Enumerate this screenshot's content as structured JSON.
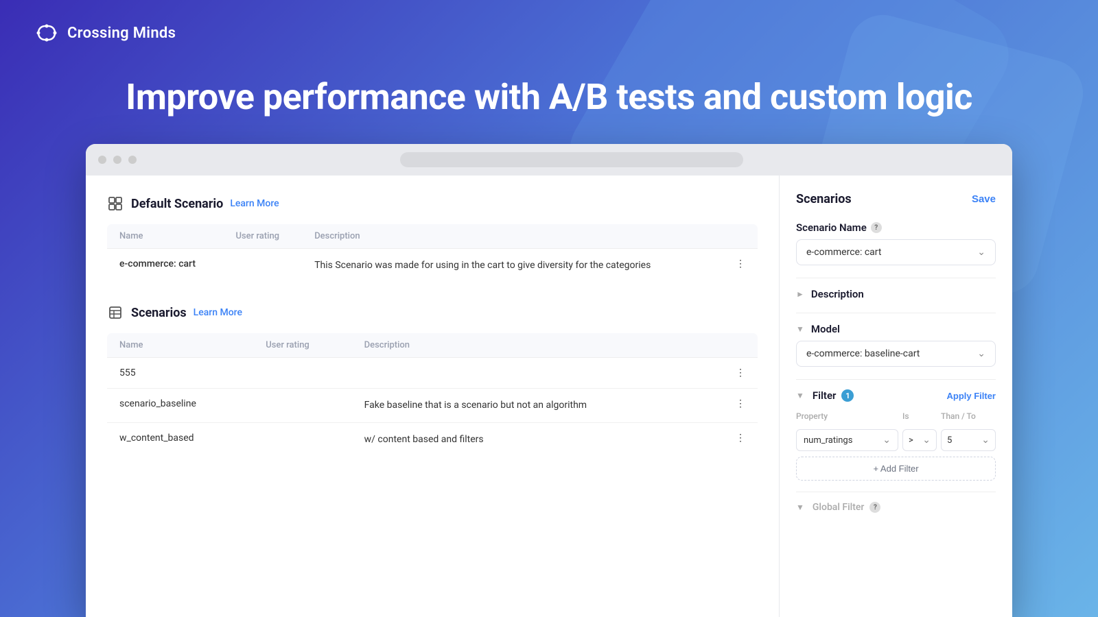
{
  "logo": {
    "text": "Crossing Minds"
  },
  "hero": {
    "title": "Improve performance with A/B tests and custom logic"
  },
  "browser": {
    "dots": [
      "dot1",
      "dot2",
      "dot3"
    ]
  },
  "defaultScenario": {
    "heading": "Default Scenario",
    "learnMore": "Learn More",
    "columns": [
      "Name",
      "User rating",
      "Description"
    ],
    "rows": [
      {
        "name": "e-commerce: cart",
        "userRating": "",
        "description": "This Scenario was made for using in the cart to give diversity for the categories"
      }
    ]
  },
  "scenarios": {
    "heading": "Scenarios",
    "learnMore": "Learn More",
    "columns": [
      "Name",
      "User rating",
      "Description"
    ],
    "rows": [
      {
        "name": "555",
        "userRating": "",
        "description": ""
      },
      {
        "name": "scenario_baseline",
        "userRating": "",
        "description": "Fake baseline that is a scenario but not an algorithm"
      },
      {
        "name": "w_content_based",
        "userRating": "",
        "description": "w/ content based and filters"
      }
    ]
  },
  "rightPanel": {
    "title": "Scenarios",
    "saveLabel": "Save",
    "scenarioNameLabel": "Scenario Name",
    "scenarioNameValue": "e-commerce: cart",
    "descriptionLabel": "Description",
    "modelLabel": "Model",
    "modelValue": "e-commerce: baseline-cart",
    "filterLabel": "Filter",
    "filterBadge": "1",
    "applyFilterLabel": "Apply Filter",
    "filterHeaders": {
      "property": "Property",
      "is": "Is",
      "thanTo": "Than / To"
    },
    "filterRow": {
      "property": "num_ratings",
      "operator": ">",
      "value": "5"
    },
    "addFilterLabel": "+ Add Filter",
    "globalFilterLabel": "Global Filter"
  }
}
